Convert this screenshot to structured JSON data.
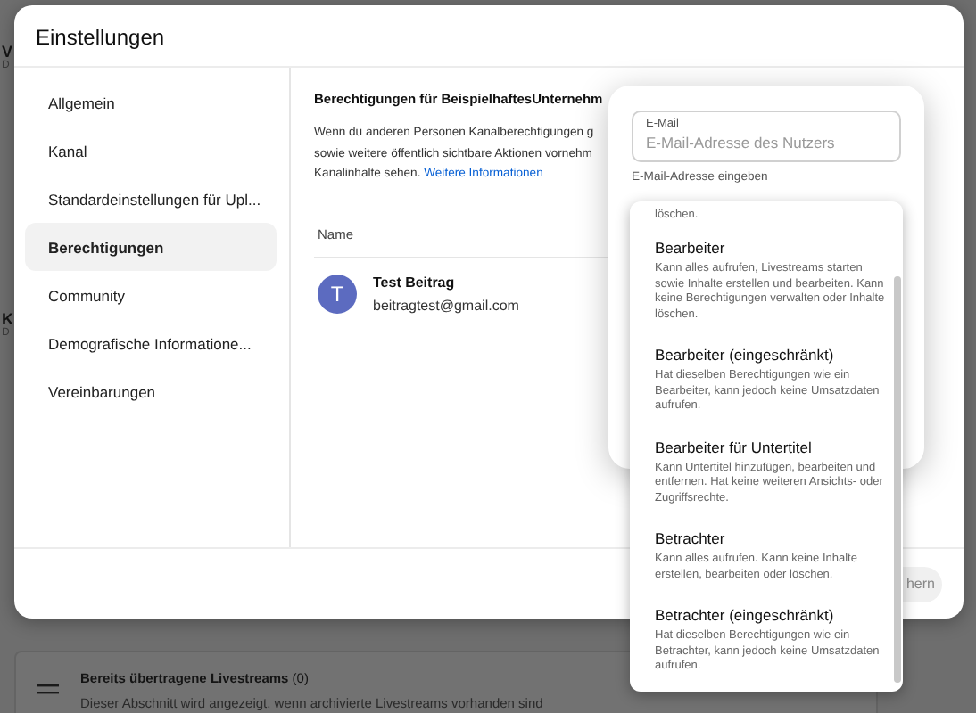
{
  "background_page": {
    "edge_letters": [
      "V",
      "D",
      "K",
      "D"
    ],
    "section": {
      "title": "**Bereits übertragene Livestreams** (0)",
      "description": "Dieser Abschnitt wird angezeigt, wenn archivierte Livestreams vorhanden sind"
    }
  },
  "dialog": {
    "title": "Einstellungen",
    "sidebar": {
      "items": [
        {
          "label": "Allgemein",
          "selected": false
        },
        {
          "label": "Kanal",
          "selected": false
        },
        {
          "label": "Standardeinstellungen für Upl...",
          "selected": false
        },
        {
          "label": "Berechtigungen",
          "selected": true
        },
        {
          "label": "Community",
          "selected": false
        },
        {
          "label": "Demografische Informatione...",
          "selected": false
        },
        {
          "label": "Vereinbarungen",
          "selected": false
        }
      ]
    },
    "content": {
      "heading": "Berechtigungen für BeispielhaftesUnternehm",
      "paragraph_lines": [
        "Wenn du anderen Personen Kanalberechtigungen g",
        "sowie weitere öffentlich sichtbare Aktionen vornehm",
        "Kanalinhalte sehen."
      ],
      "link": "Weitere Informationen",
      "table": {
        "columns": [
          "Name"
        ],
        "rows": [
          {
            "avatar_letter": "T",
            "name": "Test Beitrag",
            "email": "beitragtest@gmail.com"
          }
        ]
      }
    },
    "footer": {
      "button": "hern"
    }
  },
  "invite_popup": {
    "email_field": {
      "label": "E-Mail",
      "placeholder": "E-Mail-Adresse des Nutzers"
    },
    "helper": "E-Mail-Adresse eingeben"
  },
  "role_menu": {
    "partial_description": "löschen.",
    "options": [
      {
        "title": "Bearbeiter",
        "description": "Kann alles aufrufen, Livestreams starten sowie Inhalte erstellen und bearbeiten. Kann keine Berechtigungen verwalten oder Inhalte löschen."
      },
      {
        "title": "Bearbeiter (eingeschränkt)",
        "description": "Hat dieselben Berechtigungen wie ein Bearbeiter, kann jedoch keine Umsatzdaten aufrufen."
      },
      {
        "title": "Bearbeiter für Untertitel",
        "description": "Kann Untertitel hinzufügen, bearbeiten und entfernen. Hat keine weiteren Ansichts- oder Zugriffsrechte."
      },
      {
        "title": "Betrachter",
        "description": "Kann alles aufrufen. Kann keine Inhalte erstellen, bearbeiten oder löschen."
      },
      {
        "title": "Betrachter (eingeschränkt)",
        "description": "Hat dieselben Berechtigungen wie ein Betrachter, kann jedoch keine Umsatzdaten aufrufen."
      }
    ]
  }
}
